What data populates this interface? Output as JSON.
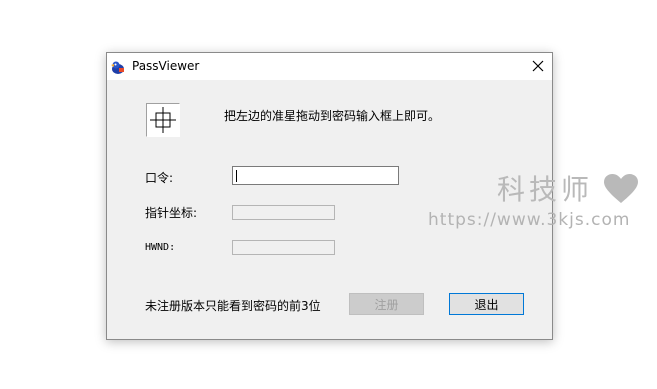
{
  "window": {
    "title": "PassViewer",
    "icon": "duck-app-icon",
    "close_icon": "close-icon"
  },
  "instruction": "把左边的准星拖动到密码输入框上即可。",
  "fields": {
    "password_label": "口令:",
    "password_value": "",
    "pointer_label": "指针坐标:",
    "pointer_value": "",
    "hwnd_label": "HWND:",
    "hwnd_value": ""
  },
  "footer": {
    "notice": "未注册版本只能看到密码的前3位",
    "register_label": "注册",
    "exit_label": "退出"
  },
  "watermark": {
    "site_name": "科技师",
    "url": "https://www.3kjs.com"
  },
  "colors": {
    "window_bg": "#f0f0f0",
    "titlebar_bg": "#ffffff",
    "watermark": "#b9b9b9",
    "default_button_border": "#0078d7"
  }
}
